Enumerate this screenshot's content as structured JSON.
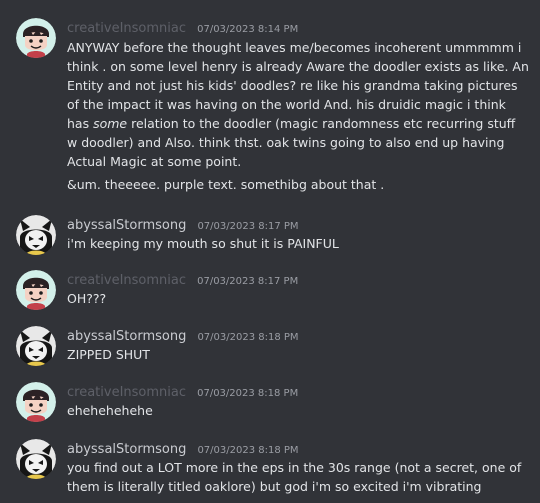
{
  "messages": [
    {
      "author": "creativeInsomniac",
      "timestamp": "07/03/2023 8:14 PM",
      "paragraphs": [
        {
          "pre": "ANYWAY before the thought leaves me/becomes incoherent ummmmm i think . on some level henry is already Aware the doodler exists as like. An Entity and not just his kids' doodles? re like his grandma taking pictures of the impact it was having on the world And. his druidic magic i think has ",
          "em": "some",
          "post": " relation to the doodler (magic randomness etc recurring stuff w doodler) and Also. think thst. oak twins going to also end up having Actual Magic at some point."
        },
        {
          "text": "&um. theeeee. purple text. somethibg about that ."
        }
      ]
    },
    {
      "author": "abyssalStormsong",
      "timestamp": "07/03/2023 8:17 PM",
      "text": "i'm keeping my mouth so shut it is PAINFUL"
    },
    {
      "author": "creativeInsomniac",
      "timestamp": "07/03/2023 8:17 PM",
      "text": "OH???"
    },
    {
      "author": "abyssalStormsong",
      "timestamp": "07/03/2023 8:18 PM",
      "text": "ZIPPED SHUT"
    },
    {
      "author": "creativeInsomniac",
      "timestamp": "07/03/2023 8:18 PM",
      "text": "ehehehehehe"
    },
    {
      "author": "abyssalStormsong",
      "timestamp": "07/03/2023 8:18 PM",
      "text": "you find out a LOT more in the eps in the 30s range (not a secret, one of them is literally titled oaklore) but god i'm so excited i'm vibrating"
    }
  ],
  "colors": {
    "background": "#313338",
    "creative_name": "#5e6068",
    "abyssal_name": "#c9cbd0",
    "timestamp": "#9a9da4",
    "message_text": "#e2e4e7"
  }
}
